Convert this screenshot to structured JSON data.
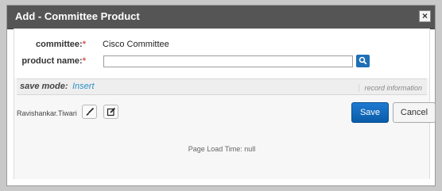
{
  "dialog": {
    "title": "Add - Committee Product",
    "close_label": "×"
  },
  "form": {
    "committee_label": "committee:",
    "committee_required": "*",
    "committee_value": "Cisco Committee",
    "product_label": "product name:",
    "product_required": "*",
    "product_value": ""
  },
  "savebar": {
    "save_mode_label": "save mode:",
    "save_mode_value": "Insert",
    "record_info": "record information"
  },
  "footer": {
    "user": "Ravishankar.Tiwari",
    "save_label": "Save",
    "cancel_label": "Cancel",
    "load_time": "Page Load Time: null"
  },
  "icons": {
    "close": "close-icon",
    "lookup": "search-icon",
    "brush": "brush-icon",
    "edit": "edit-icon"
  },
  "colors": {
    "titlebar": "#555555",
    "required": "#d9534f",
    "link": "#2f8fc7",
    "primary": "#1f7ad0"
  }
}
